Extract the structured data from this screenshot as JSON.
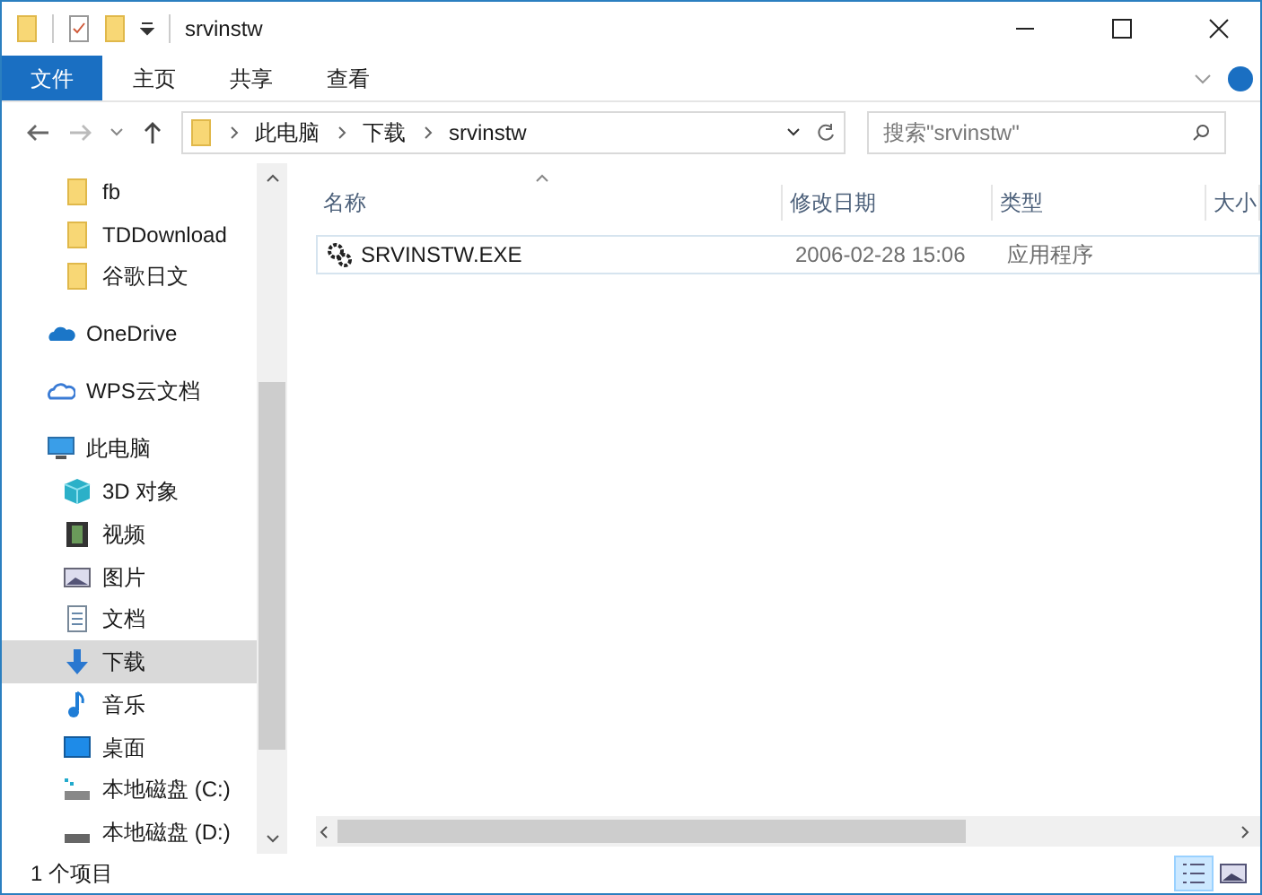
{
  "window": {
    "title": "srvinstw"
  },
  "ribbon_tabs": [
    {
      "label": "文件",
      "kind": "file"
    },
    {
      "label": "主页",
      "kind": "tab"
    },
    {
      "label": "共享",
      "kind": "tab"
    },
    {
      "label": "查看",
      "kind": "tab"
    }
  ],
  "address_bar": {
    "path": [
      "此电脑",
      "下载",
      "srvinstw"
    ]
  },
  "search": {
    "placeholder": "搜索\"srvinstw\""
  },
  "sidebar": {
    "scrolled_children": [
      {
        "label": "fb",
        "kind": "folder",
        "selected": false
      },
      {
        "label": "TDDownload",
        "kind": "folder",
        "selected": false
      },
      {
        "label": "谷歌日文",
        "kind": "folder",
        "selected": false
      }
    ],
    "items": [
      {
        "label": "OneDrive",
        "kind": "onedrive",
        "selected": false
      },
      {
        "label": "WPS云文档",
        "kind": "cloud",
        "selected": false
      },
      {
        "label": "此电脑",
        "kind": "pc",
        "selected": false,
        "children": [
          {
            "label": "3D 对象",
            "kind": "cube",
            "selected": false
          },
          {
            "label": "视频",
            "kind": "video",
            "selected": false
          },
          {
            "label": "图片",
            "kind": "picture",
            "selected": false
          },
          {
            "label": "文档",
            "kind": "document",
            "selected": false
          },
          {
            "label": "下载",
            "kind": "download",
            "selected": true
          },
          {
            "label": "音乐",
            "kind": "music",
            "selected": false
          },
          {
            "label": "桌面",
            "kind": "desktop",
            "selected": false
          },
          {
            "label": "本地磁盘 (C:)",
            "kind": "system-drive",
            "selected": false
          },
          {
            "label": "本地磁盘 (D:)",
            "kind": "drive",
            "selected": false
          }
        ]
      }
    ]
  },
  "table": {
    "columns": [
      "名称",
      "修改日期",
      "类型",
      "大小"
    ],
    "rows": [
      {
        "name": "SRVINSTW.EXE",
        "modified": "2006-02-28 15:06",
        "type": "应用程序",
        "selected": false
      }
    ]
  },
  "status_bar": {
    "count": "1 个项目",
    "views": [
      {
        "kind": "details",
        "selected": true
      },
      {
        "kind": "thumbnails",
        "selected": false
      }
    ]
  }
}
